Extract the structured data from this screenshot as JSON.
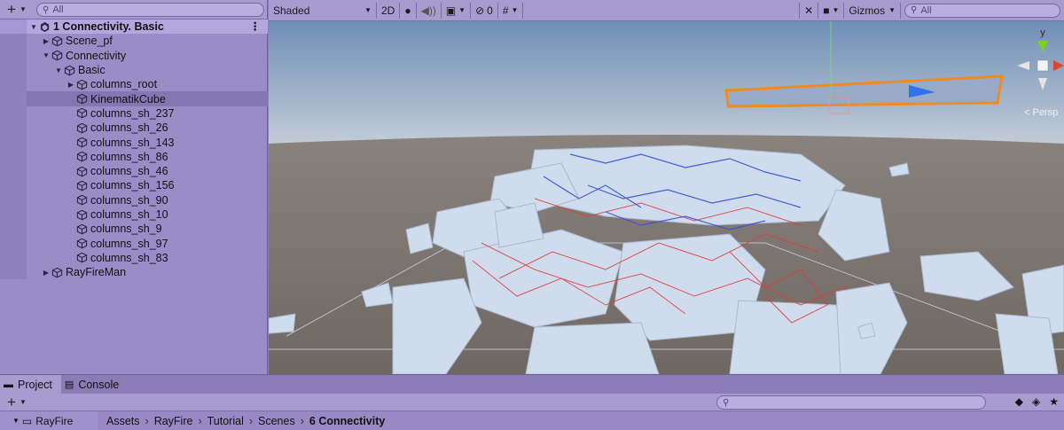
{
  "hierarchy": {
    "search_placeholder": "All",
    "scene_name": "1 Connectivity. Basic",
    "items": [
      {
        "label": "Scene_pf",
        "depth": 1,
        "arrow": "▶"
      },
      {
        "label": "Connectivity",
        "depth": 1,
        "arrow": "▼"
      },
      {
        "label": "Basic",
        "depth": 2,
        "arrow": "▼"
      },
      {
        "label": "columns_root",
        "depth": 3,
        "arrow": "▶"
      },
      {
        "label": "KinematikCube",
        "depth": 3,
        "arrow": "",
        "selected": true
      },
      {
        "label": "columns_sh_237",
        "depth": 3,
        "arrow": ""
      },
      {
        "label": "columns_sh_26",
        "depth": 3,
        "arrow": ""
      },
      {
        "label": "columns_sh_143",
        "depth": 3,
        "arrow": ""
      },
      {
        "label": "columns_sh_86",
        "depth": 3,
        "arrow": ""
      },
      {
        "label": "columns_sh_46",
        "depth": 3,
        "arrow": ""
      },
      {
        "label": "columns_sh_156",
        "depth": 3,
        "arrow": ""
      },
      {
        "label": "columns_sh_90",
        "depth": 3,
        "arrow": ""
      },
      {
        "label": "columns_sh_10",
        "depth": 3,
        "arrow": ""
      },
      {
        "label": "columns_sh_9",
        "depth": 3,
        "arrow": ""
      },
      {
        "label": "columns_sh_97",
        "depth": 3,
        "arrow": ""
      },
      {
        "label": "columns_sh_83",
        "depth": 3,
        "arrow": ""
      },
      {
        "label": "RayFireMan",
        "depth": 1,
        "arrow": "▶"
      }
    ]
  },
  "scene_toolbar": {
    "shading_mode": "Shaded",
    "mode_2d": "2D",
    "hidden_count": "0",
    "gizmos_label": "Gizmos",
    "search_placeholder": "All"
  },
  "scene_view": {
    "projection_label": "< Persp",
    "axis_y": "y",
    "colors": {
      "sky_top": "#6f8fb6",
      "sky_bottom": "#c7d0da",
      "ground": "#7a726d",
      "fragments": "#cfdcee",
      "selection_outline": "#f08a24",
      "connection_red": "#e03a3a",
      "connection_blue": "#3550d8"
    }
  },
  "bottom_panel": {
    "tabs": [
      {
        "label": "Project",
        "icon": "folder-icon",
        "active": true
      },
      {
        "label": "Console",
        "icon": "console-icon",
        "active": false
      }
    ],
    "folder_tree_root": "RayFire",
    "breadcrumb": [
      "Assets",
      "RayFire",
      "Tutorial",
      "Scenes",
      "6 Connectivity"
    ]
  }
}
